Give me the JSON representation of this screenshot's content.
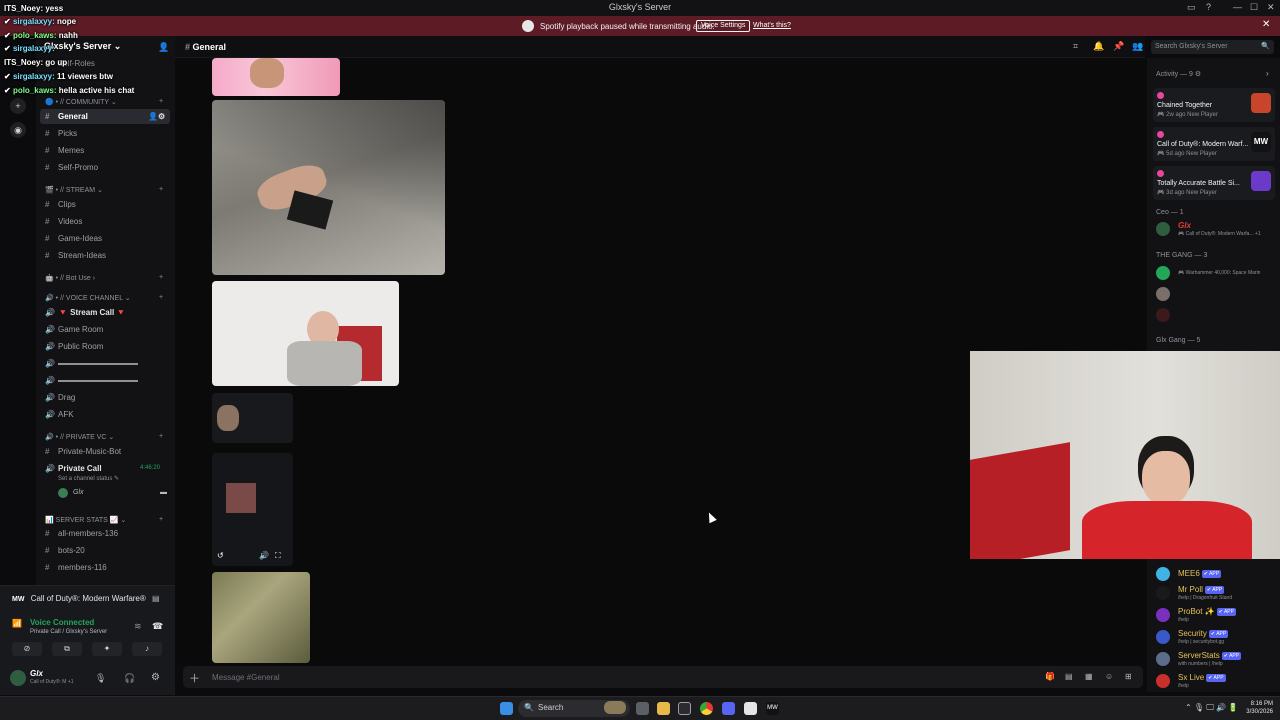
{
  "window": {
    "title": "Glxsky's Server",
    "controls": [
      "▭",
      "?",
      "—",
      "☐",
      "✕"
    ]
  },
  "notice": {
    "message": "Spotify playback paused while transmitting audio.",
    "button": "Voice Settings",
    "link": "What's this?",
    "close": "✕"
  },
  "overlay": [
    {
      "user": "ITS_Noey:",
      "text": "yess"
    },
    {
      "user": "sirgalaxyy:",
      "text": "nope"
    },
    {
      "user": "polo_kaws:",
      "text": "nahh"
    },
    {
      "user": "sirgalaxyy:",
      "text": ""
    },
    {
      "user": "ITS_Noey:",
      "text": "go up"
    },
    {
      "user": "sirgalaxyy:",
      "text": "11 viewers btw"
    },
    {
      "user": "polo_kaws:",
      "text": "hella active his chat"
    }
  ],
  "server": {
    "name": "Glxsky's Server"
  },
  "sidebar": {
    "categories": {
      "community": "• // COMMUNITY",
      "stream": "• // STREAM",
      "botuse": "• // Bot Use",
      "voice": "• // VOICE CHANNEL",
      "privatevc": "• // PRIVATE VC",
      "stats": "SERVER STATS"
    },
    "self_roles": "Self-Roles",
    "channels": {
      "general": "General",
      "picks": "Picks",
      "memes": "Memes",
      "selfpromo": "Self-Promo",
      "clips": "Clips",
      "videos": "Videos",
      "gameideas": "Game-Ideas",
      "streamideas": "Stream-Ideas",
      "streamcall": "🔻 Stream Call 🔻",
      "gameroom": "Game Room",
      "publicroom": "Public Room",
      "drag": "Drag",
      "afk": "AFK",
      "privatemusic": "Private-Music-Bot",
      "privatecall": "Private Call",
      "privatecall_time": "4:46:20",
      "channel_status": "Set a channel status ✎",
      "vc_user": "Glx",
      "allmembers": "all-members-136",
      "bots": "bots-20",
      "members": "members-116"
    }
  },
  "panel": {
    "game": "Call of Duty®: Modern Warfare®",
    "voice_connected": "Voice Connected",
    "voice_location": "Private Call / Glxsky's Server",
    "user": "Glx",
    "user_status": "Call of Duty®: M +1"
  },
  "header": {
    "channel": "General",
    "search_placeholder": "Search Glxsky's Server"
  },
  "composer": {
    "placeholder": "Message #General"
  },
  "members": {
    "activity_title": "Activity — 9 ⚙",
    "activities": [
      {
        "game": "Chained Together",
        "sub": "🎮 2w ago   New Player"
      },
      {
        "game": "Call of Duty®: Modern Warf...",
        "sub": "🎮 5d ago   New Player"
      },
      {
        "game": "Totally Accurate Battle Si...",
        "sub": "🎮 3d ago   New Player"
      }
    ],
    "groups": {
      "ceo": "Ceo — 1",
      "gang": "THE GANG — 3",
      "glxgang": "Glx Gang — 5"
    },
    "ceo_member": {
      "name": "Glx",
      "status": "🎮 Call of Duty®: Modern Warfa... +1"
    },
    "gang_status": "🎮 Warhammer 40,000: Space Marin",
    "bots": [
      {
        "name": "MEE6",
        "badge": "✔ APP",
        "sub": ""
      },
      {
        "name": "Mr Poll",
        "badge": "✔ APP",
        "sub": "/help | Dragonfruit Stand"
      },
      {
        "name": "ProBot ✨",
        "badge": "✔ APP",
        "sub": "/help"
      },
      {
        "name": "Security",
        "badge": "✔ APP",
        "sub": "/help | securitybot.gg"
      },
      {
        "name": "ServerStats",
        "badge": "✔ APP",
        "sub": "with numbers | /help"
      },
      {
        "name": "Sx Live",
        "badge": "✔ APP",
        "sub": "/help"
      }
    ]
  },
  "taskbar": {
    "search": "Search",
    "time": "8:16 PM",
    "date": "3/30/2026"
  },
  "colors": {
    "accent": "#5865f2",
    "notice": "#5c1b25",
    "online": "#23a55a"
  }
}
